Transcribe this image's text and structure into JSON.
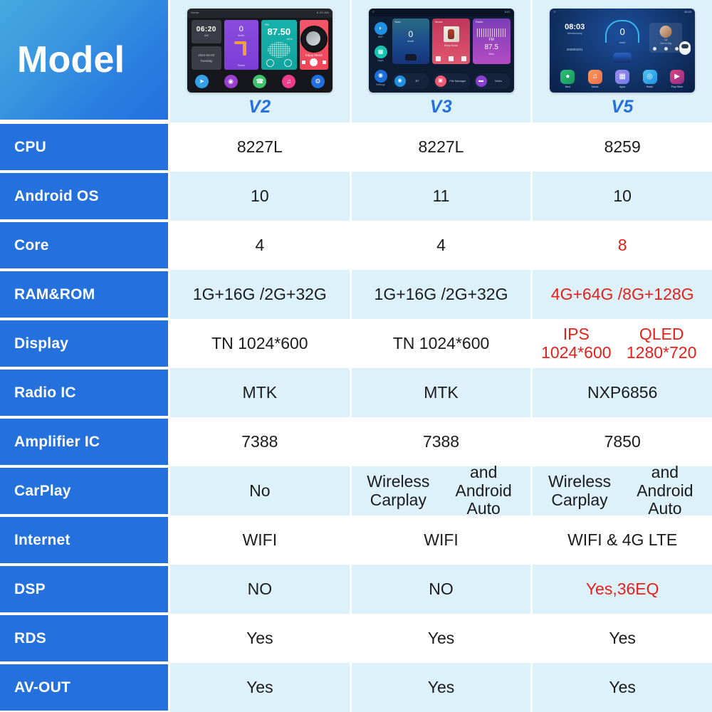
{
  "header": {
    "label": "Model",
    "products": [
      {
        "name": "V2",
        "screen": {
          "status_left": "Home",
          "status_right": "6:20 AM",
          "clock_time": "06:20",
          "clock_ampm": "AM",
          "date": "2021-02-02",
          "weekday": "Tuesday",
          "speed_value": "0",
          "speed_unit": "km/h",
          "speed_label": "Road",
          "radio_label": "FM",
          "radio_freq": "87.50",
          "radio_unit": "MHz",
          "music_label": "Enjoy Music",
          "dock": [
            "navigation-icon",
            "steering-icon",
            "phone-icon",
            "music-icon",
            "settings-icon"
          ]
        }
      },
      {
        "name": "V3",
        "screen": {
          "status_right": "8:01",
          "side_items": [
            "WiFi",
            "Apps",
            "Settings"
          ],
          "nav_title": "Navi",
          "nav_value": "0",
          "nav_unit": "km/h",
          "music_title": "Music",
          "music_track": "Enjoy Music",
          "radio_title": "Radio",
          "radio_label": "FM",
          "radio_freq": "87.5",
          "radio_unit": "MHz",
          "buttons": [
            "BT",
            "File Manager",
            "Video"
          ]
        }
      },
      {
        "name": "V5",
        "screen": {
          "status_right": "08:03",
          "clock_time": "08:03",
          "weekday": "Wednesday",
          "date": "2020/01/01",
          "gauge_value": "0",
          "gauge_unit": "km/h",
          "music_title": "JJ",
          "music_artist": "Give a Hug",
          "dock": [
            "Navi",
            "Music",
            "Apps",
            "Radio",
            "Play Store"
          ]
        }
      }
    ]
  },
  "rows": [
    {
      "label": "CPU",
      "values": [
        "8227L",
        "8227L",
        "8259"
      ],
      "highlight": [
        false,
        false,
        false
      ]
    },
    {
      "label": "Android OS",
      "values": [
        "10",
        "11",
        "10"
      ],
      "highlight": [
        false,
        false,
        false
      ]
    },
    {
      "label": "Core",
      "values": [
        "4",
        "4",
        "8"
      ],
      "highlight": [
        false,
        false,
        true
      ]
    },
    {
      "label": "RAM&ROM",
      "values": [
        "1G+16G /2G+32G",
        "1G+16G /2G+32G",
        "4G+64G /8G+128G"
      ],
      "highlight": [
        false,
        false,
        true
      ]
    },
    {
      "label": "Display",
      "values": [
        "TN 1024*600",
        "TN 1024*600",
        "IPS 1024*600\nQLED 1280*720"
      ],
      "highlight": [
        false,
        false,
        true
      ]
    },
    {
      "label": "Radio IC",
      "values": [
        "MTK",
        "MTK",
        "NXP6856"
      ],
      "highlight": [
        false,
        false,
        false
      ]
    },
    {
      "label": "Amplifier IC",
      "values": [
        "7388",
        "7388",
        "7850"
      ],
      "highlight": [
        false,
        false,
        false
      ]
    },
    {
      "label": "CarPlay",
      "values": [
        "No",
        "Wireless Carplay\nand Android Auto",
        "Wireless Carplay\nand Android Auto"
      ],
      "highlight": [
        false,
        false,
        false
      ]
    },
    {
      "label": "Internet",
      "values": [
        "WIFI",
        "WIFI",
        "WIFI & 4G LTE"
      ],
      "highlight": [
        false,
        false,
        false
      ]
    },
    {
      "label": "DSP",
      "values": [
        "NO",
        "NO",
        "Yes,36EQ"
      ],
      "highlight": [
        false,
        false,
        true
      ]
    },
    {
      "label": "RDS",
      "values": [
        "Yes",
        "Yes",
        "Yes"
      ],
      "highlight": [
        false,
        false,
        false
      ]
    },
    {
      "label": "AV-OUT",
      "values": [
        "Yes",
        "Yes",
        "Yes"
      ],
      "highlight": [
        false,
        false,
        false
      ]
    }
  ],
  "colors": {
    "label_blue": "#2470dd",
    "gradient_start": "#46aadd",
    "gradient_end": "#2470dd",
    "row_alt": "#ddf1fb",
    "highlight_red": "#e8201a",
    "model_name_blue": "#2470dd"
  }
}
